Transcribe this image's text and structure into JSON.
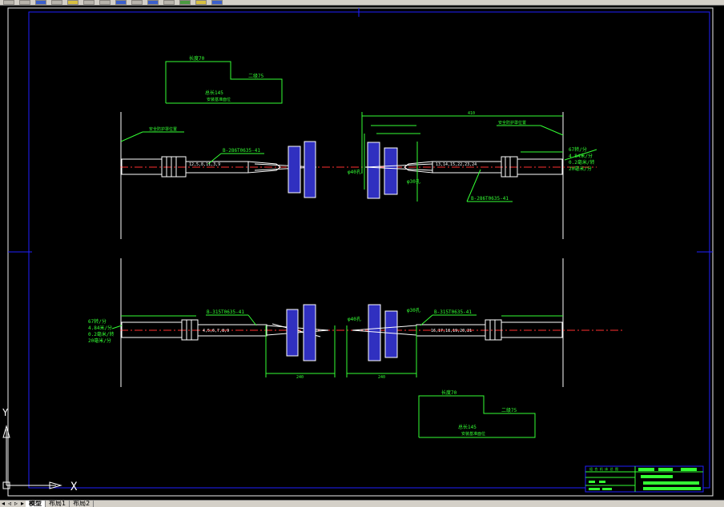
{
  "toolbar": {
    "icons": [
      "new-icon",
      "open-icon",
      "save-icon",
      "print-icon",
      "cut-icon",
      "copy-icon",
      "paste-icon",
      "undo-icon",
      "redo-icon",
      "pan-icon",
      "zoom-icon",
      "properties-icon",
      "layer-icon",
      "help-icon"
    ]
  },
  "colors": {
    "background": "#000000",
    "frame": "#2020ff",
    "dimension": "#33ff33",
    "geometry": "#ffffff",
    "centerline": "#ff3030",
    "fixture": "#3030c0"
  },
  "top_left_box": {
    "width_label": "长度70",
    "step_label": "二级75",
    "total_label": "总长145",
    "note": "安装基准面位"
  },
  "bottom_right_box": {
    "width_label": "长度70",
    "step_label": "二级75",
    "total_label": "总长145",
    "note": "安装基准面位"
  },
  "top_view": {
    "left_ref_note": "安全防护罩位置",
    "left_part_code": "B-286T0635-41",
    "left_id": "12,5,8,11,3,9",
    "right_ref_note": "安全防护罩位置",
    "right_part_code": "B-286T0635-41",
    "right_id": "13,14,15,22,23,24",
    "dia_40": "φ40孔",
    "dia_30": "φ30孔",
    "top_dim": "410",
    "speed": [
      "67转/分",
      "4.84米/分",
      "0.2毫米/转",
      "20毫米/分"
    ]
  },
  "bottom_view": {
    "left_part_code": "B-315T0635-41",
    "left_id": "4,5,6,7,8,9",
    "right_part_code": "B-315T0635-41",
    "right_id": "16,17,18,19,20,21",
    "dia_40": "φ40孔",
    "dia_30": "φ30孔",
    "dim_left": "240",
    "dim_right": "240",
    "speed": [
      "67转/分",
      "4.84米/分",
      "0.2毫米/转",
      "20毫米/分"
    ]
  },
  "title_block": {
    "header": "组 合 机 床 总 图"
  },
  "ucs": {
    "x_label": "X",
    "y_label": "Y"
  },
  "tabs": {
    "model": "模型",
    "layout1": "布局1",
    "layout2": "布局2"
  }
}
